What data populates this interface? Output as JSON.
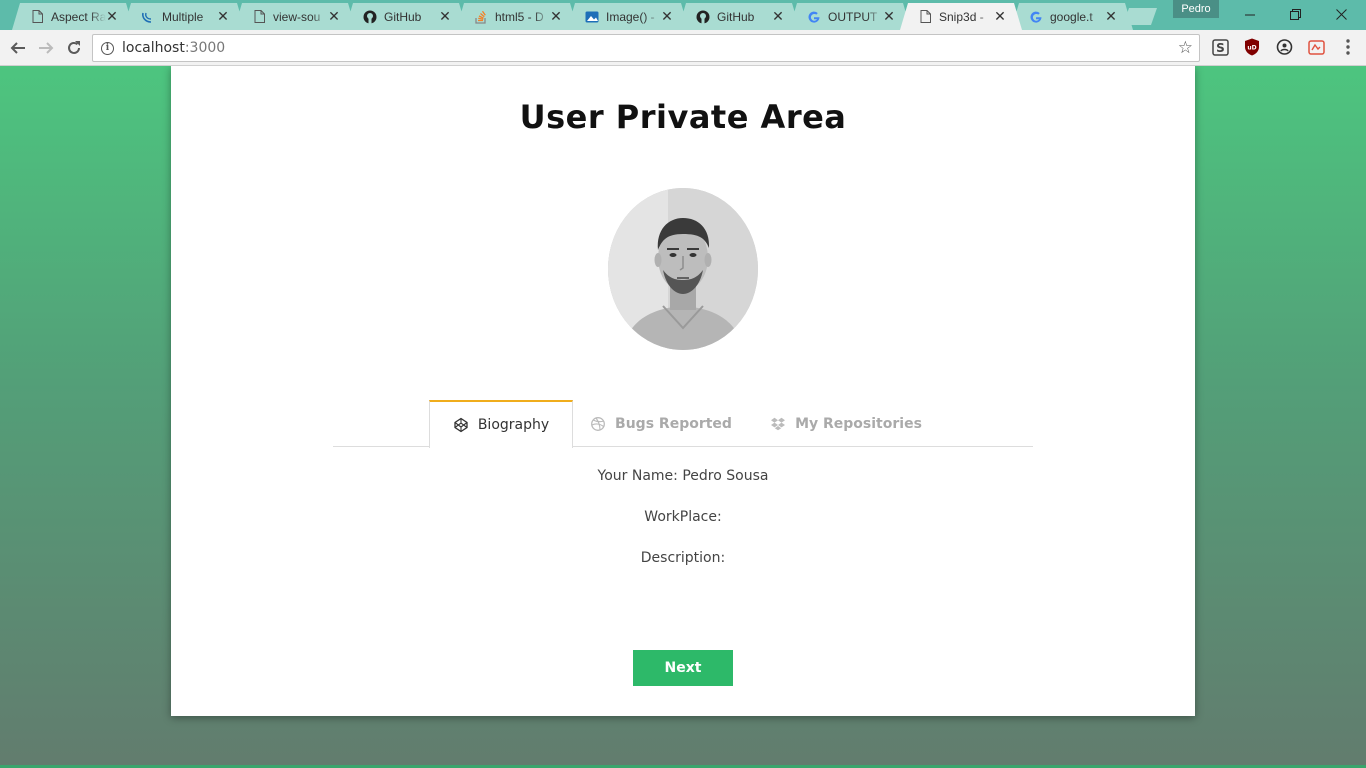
{
  "browser": {
    "tabs": [
      {
        "title": "Aspect Ra",
        "favicon": "page-icon",
        "active": false
      },
      {
        "title": "Multiple",
        "favicon": "jquery-icon",
        "active": false
      },
      {
        "title": "view-sou",
        "favicon": "page-icon",
        "active": false
      },
      {
        "title": "GitHub",
        "favicon": "github-icon",
        "active": false
      },
      {
        "title": "html5 - D",
        "favicon": "stackoverflow-icon",
        "active": false
      },
      {
        "title": "Image() -",
        "favicon": "image-icon",
        "active": false
      },
      {
        "title": "GitHub",
        "favicon": "github-icon",
        "active": false
      },
      {
        "title": "OUTPUT",
        "favicon": "google-icon",
        "active": false
      },
      {
        "title": "Snip3d -",
        "favicon": "page-icon",
        "active": true
      },
      {
        "title": "google.t",
        "favicon": "google-icon",
        "active": false
      }
    ],
    "profile_name": "Pedro",
    "url_host": "localhost",
    "url_port": ":3000"
  },
  "page": {
    "title": "User Private Area",
    "tabs": [
      {
        "label": "Biography",
        "icon": "codepen-icon",
        "active": true
      },
      {
        "label": "Bugs Reported",
        "icon": "dribbble-icon",
        "active": false
      },
      {
        "label": "My Repositories",
        "icon": "dropbox-icon",
        "active": false
      }
    ],
    "fields": {
      "name_label": "Your Name: Pedro Sousa",
      "workplace_label": "WorkPlace:",
      "description_label": "Description:"
    },
    "next_label": "Next"
  },
  "colors": {
    "accent_tab": "#f0ad1c",
    "button_green": "#2db969",
    "bg_gradient_top": "#4dc57f",
    "bg_gradient_bottom": "#627c6e"
  }
}
